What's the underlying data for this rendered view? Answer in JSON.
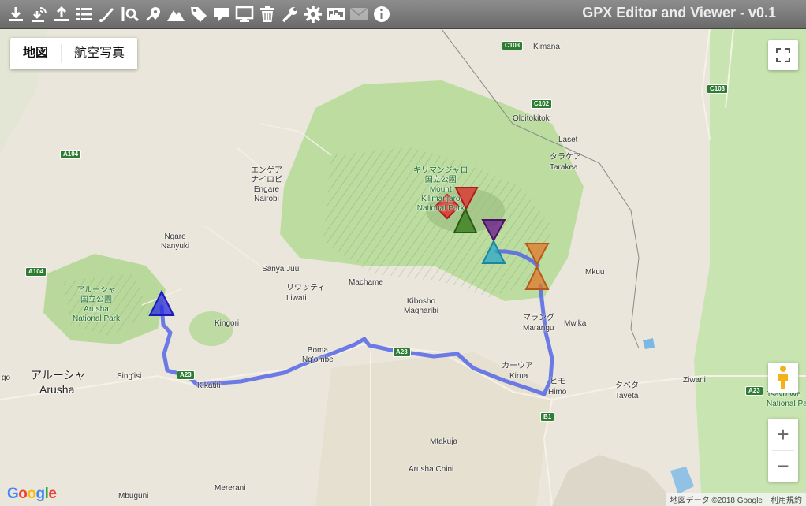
{
  "app": {
    "title": "GPX Editor and Viewer - v0.1"
  },
  "toolbar": {
    "tools": [
      {
        "icon": "download-icon"
      },
      {
        "icon": "download-multi-icon"
      },
      {
        "icon": "upload-icon"
      },
      {
        "icon": "list-icon"
      },
      {
        "icon": "pen-icon"
      },
      {
        "icon": "search-waypoint-icon"
      },
      {
        "icon": "map-marker-icon"
      },
      {
        "icon": "mountain-icon"
      },
      {
        "icon": "tag-icon"
      },
      {
        "icon": "comment-icon"
      },
      {
        "icon": "monitor-icon"
      },
      {
        "icon": "trash-icon"
      },
      {
        "icon": "wrench-icon"
      },
      {
        "icon": "gear-icon"
      },
      {
        "icon": "world-map-icon"
      },
      {
        "icon": "envelope-icon",
        "disabled": true
      },
      {
        "icon": "info-icon"
      }
    ]
  },
  "map_controls": {
    "map_type": [
      "地図",
      "航空写真"
    ],
    "zoom_in": "+",
    "zoom_out": "−"
  },
  "attribution": {
    "google": "Google",
    "data": "地図データ ©2018 Google",
    "terms": "利用規約"
  },
  "roads": [
    "C103",
    "C103",
    "C102",
    "A104",
    "A104",
    "A23",
    "A23",
    "A23",
    "B1"
  ],
  "places": {
    "kimana": "Kimana",
    "oloitokitok": "Oloitokitok",
    "laset": "Laset",
    "tarakea_jp": "タラケア",
    "tarakea": "Tarakea",
    "kili_park": [
      "キリマンジャロ",
      "国立公園",
      "Mount",
      "Kilimanjaro",
      "National Park"
    ],
    "engare_jp": [
      "エンゲア",
      "ナイロビ"
    ],
    "engare": [
      "Engare",
      "Nairobi"
    ],
    "ngare": [
      "Ngare",
      "Nanyuki"
    ],
    "sanya": "Sanya Juu",
    "liwati_jp": "リワッティ",
    "liwati": "Liwati",
    "machame": "Machame",
    "mkuu": "Mkuu",
    "arusha_park": [
      "アルーシャ",
      "国立公園",
      "Arusha",
      "National Park"
    ],
    "kingori": "Kingori",
    "kibosho": [
      "Kibosho",
      "Magharibi"
    ],
    "marangu_jp": "マラング",
    "marangu": "Marangu",
    "mwika": "Mwika",
    "boma": [
      "Boma",
      "Ng'ombe"
    ],
    "arusha_jp": "アルーシャ",
    "arusha": "Arusha",
    "singisi": "Sing'isi",
    "kikatiti": "Kikatiti",
    "kirua_jp": "カーウア",
    "kirua": "Kirua",
    "himo_jp": "ヒモ",
    "himo": "Himo",
    "taveta_jp": "タベタ",
    "taveta": "Taveta",
    "ziwani": "Ziwani",
    "tsavo": [
      "Tsavo We",
      "National Pa"
    ],
    "mtakuja": "Mtakuja",
    "arusha_chini": "Arusha Chini",
    "mbuguni": "Mbuguni",
    "mererani": "Mererani",
    "go": "go"
  },
  "waypoint_colors": [
    "#2a2adf",
    "#e02a2a",
    "#3a7d1e",
    "#6b1e8e",
    "#2aa7c7",
    "#e07a2a"
  ],
  "track_color": "#5566e6"
}
